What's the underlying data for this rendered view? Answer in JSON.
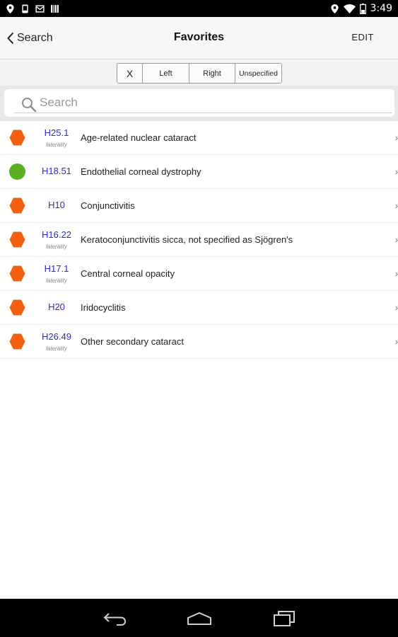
{
  "status_bar": {
    "time": "3:49",
    "left_icons": [
      "location-icon",
      "device-icon",
      "mail-icon",
      "barcode-icon"
    ],
    "right_icons": [
      "location-icon",
      "wifi-icon",
      "battery-icon"
    ]
  },
  "nav": {
    "back_label": "Search",
    "title": "Favorites",
    "edit_label": "EDIT"
  },
  "filter": {
    "options": [
      "X",
      "Left",
      "Right",
      "Unspecified"
    ]
  },
  "search": {
    "placeholder": "Search",
    "value": ""
  },
  "favorites": [
    {
      "code": "H25.1",
      "laterality": "laterality",
      "description": "Age-related nuclear cataract",
      "icon": "orange-hexagon-icon"
    },
    {
      "code": "H18.51",
      "laterality": "",
      "description": "Endothelial corneal dystrophy",
      "icon": "green-circle-icon"
    },
    {
      "code": "H10",
      "laterality": "",
      "description": "Conjunctivitis",
      "icon": "orange-hexagon-icon"
    },
    {
      "code": "H16.22",
      "laterality": "laterality",
      "description": "Keratoconjunctivitis sicca, not specified as Sjögren's",
      "icon": "orange-hexagon-icon"
    },
    {
      "code": "H17.1",
      "laterality": "laterality",
      "description": "Central corneal opacity",
      "icon": "orange-hexagon-icon"
    },
    {
      "code": "H20",
      "laterality": "",
      "description": "Iridocyclitis",
      "icon": "orange-hexagon-icon"
    },
    {
      "code": "H26.49",
      "laterality": "laterality",
      "description": "Other secondary cataract",
      "icon": "orange-hexagon-icon"
    }
  ],
  "colors": {
    "code_text": "#2b2bd6",
    "hexagon_orange": "#f06010",
    "circle_green": "#5aaf22",
    "status_bar": "#000000"
  }
}
